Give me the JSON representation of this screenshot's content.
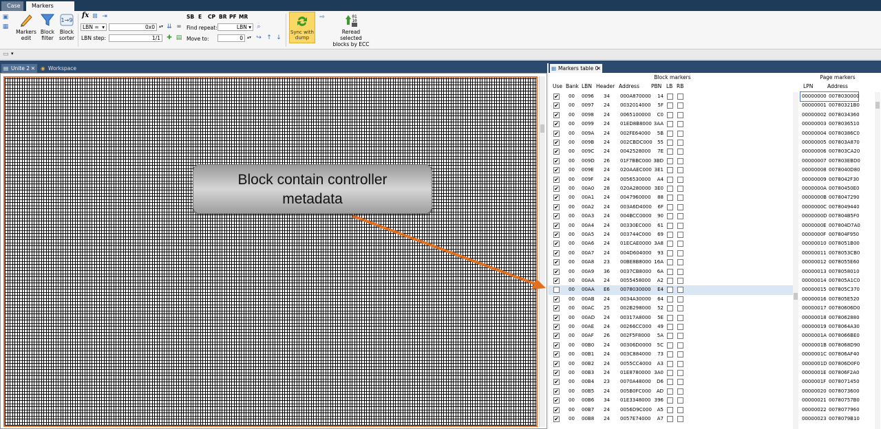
{
  "ribbon_tabs": [
    "Case",
    "Markers table"
  ],
  "toolbar": {
    "markers_edit": "Markers\nedit",
    "block_filter": "Block\nfilter",
    "block_sorter": "Block\nsorter",
    "fx_label": "fx",
    "lbn_selector": "LBN =",
    "lbn_value": "0x0",
    "lbn_step_label": "LBN step:",
    "lbn_step_value": "1/1",
    "format_buttons": [
      "SB",
      "E",
      "CP",
      "BR",
      "PF",
      "MR"
    ],
    "find_repeat_label": "Find repeat:",
    "find_repeat_value": "LBN",
    "move_to_label": "Move to:",
    "move_to_value": "0",
    "sync_label": "Sync with\ndump",
    "reread_label": "Reread selected\nblocks by ECC"
  },
  "doc_tabs": {
    "left": [
      "Unite 2",
      "Workspace"
    ],
    "right": [
      "Markers table 0"
    ]
  },
  "block_markers": {
    "title": "Block markers",
    "columns": [
      "Use",
      "Bank",
      "LBN",
      "Header",
      "Address",
      "PBN",
      "LB",
      "RB"
    ],
    "rows": [
      {
        "use": true,
        "bank": "00",
        "lbn": "0096",
        "header": "34",
        "address": "000A870000",
        "pbn": "14"
      },
      {
        "use": true,
        "bank": "00",
        "lbn": "0097",
        "header": "24",
        "address": "0032014000",
        "pbn": "5F"
      },
      {
        "use": true,
        "bank": "00",
        "lbn": "0098",
        "header": "24",
        "address": "0065100000",
        "pbn": "C0"
      },
      {
        "use": true,
        "bank": "00",
        "lbn": "0099",
        "header": "24",
        "address": "01ED8B8000",
        "pbn": "3AA"
      },
      {
        "use": true,
        "bank": "00",
        "lbn": "009A",
        "header": "24",
        "address": "002FE64000",
        "pbn": "5B"
      },
      {
        "use": true,
        "bank": "00",
        "lbn": "009B",
        "header": "24",
        "address": "002CBDC000",
        "pbn": "55"
      },
      {
        "use": true,
        "bank": "00",
        "lbn": "009C",
        "header": "24",
        "address": "0042528000",
        "pbn": "7E"
      },
      {
        "use": true,
        "bank": "00",
        "lbn": "009D",
        "header": "26",
        "address": "01F7BBC000",
        "pbn": "3BD"
      },
      {
        "use": true,
        "bank": "00",
        "lbn": "009E",
        "header": "24",
        "address": "020AAEC000",
        "pbn": "3E1"
      },
      {
        "use": true,
        "bank": "00",
        "lbn": "009F",
        "header": "24",
        "address": "0056530000",
        "pbn": "A4"
      },
      {
        "use": true,
        "bank": "00",
        "lbn": "00A0",
        "header": "28",
        "address": "020A280000",
        "pbn": "3E0"
      },
      {
        "use": true,
        "bank": "00",
        "lbn": "00A1",
        "header": "24",
        "address": "0047960000",
        "pbn": "88"
      },
      {
        "use": true,
        "bank": "00",
        "lbn": "00A2",
        "header": "24",
        "address": "003A6D4000",
        "pbn": "6F"
      },
      {
        "use": true,
        "bank": "00",
        "lbn": "00A3",
        "header": "24",
        "address": "004BCC0000",
        "pbn": "90"
      },
      {
        "use": true,
        "bank": "00",
        "lbn": "00A4",
        "header": "24",
        "address": "00330EC000",
        "pbn": "61"
      },
      {
        "use": true,
        "bank": "00",
        "lbn": "00A5",
        "header": "24",
        "address": "003744C000",
        "pbn": "69"
      },
      {
        "use": true,
        "bank": "00",
        "lbn": "00A6",
        "header": "24",
        "address": "01ECAE0000",
        "pbn": "3A8"
      },
      {
        "use": true,
        "bank": "00",
        "lbn": "00A7",
        "header": "24",
        "address": "004D604000",
        "pbn": "93"
      },
      {
        "use": true,
        "bank": "00",
        "lbn": "00A8",
        "header": "23",
        "address": "00BE8B8000",
        "pbn": "16A"
      },
      {
        "use": true,
        "bank": "00",
        "lbn": "00A9",
        "header": "36",
        "address": "0037CB8000",
        "pbn": "6A"
      },
      {
        "use": true,
        "bank": "00",
        "lbn": "00AA",
        "header": "24",
        "address": "0055458000",
        "pbn": "A2"
      },
      {
        "use": false,
        "bank": "00",
        "lbn": "00AA",
        "header": "E6",
        "address": "0078030000",
        "pbn": "E4",
        "selected": true
      },
      {
        "use": true,
        "bank": "00",
        "lbn": "00AB",
        "header": "24",
        "address": "0034A30000",
        "pbn": "64"
      },
      {
        "use": true,
        "bank": "00",
        "lbn": "00AC",
        "header": "25",
        "address": "002B298000",
        "pbn": "52"
      },
      {
        "use": true,
        "bank": "00",
        "lbn": "00AD",
        "header": "24",
        "address": "00317A8000",
        "pbn": "5E"
      },
      {
        "use": true,
        "bank": "00",
        "lbn": "00AE",
        "header": "24",
        "address": "00266CC000",
        "pbn": "49"
      },
      {
        "use": true,
        "bank": "00",
        "lbn": "00AF",
        "header": "26",
        "address": "002F5F8000",
        "pbn": "5A"
      },
      {
        "use": true,
        "bank": "00",
        "lbn": "00B0",
        "header": "24",
        "address": "00306D0000",
        "pbn": "5C"
      },
      {
        "use": true,
        "bank": "00",
        "lbn": "00B1",
        "header": "24",
        "address": "003C884000",
        "pbn": "73"
      },
      {
        "use": true,
        "bank": "00",
        "lbn": "00B2",
        "header": "24",
        "address": "0055CC4000",
        "pbn": "A3"
      },
      {
        "use": true,
        "bank": "00",
        "lbn": "00B3",
        "header": "24",
        "address": "01E8780000",
        "pbn": "3A0"
      },
      {
        "use": true,
        "bank": "00",
        "lbn": "00B4",
        "header": "23",
        "address": "0070A48000",
        "pbn": "D6"
      },
      {
        "use": true,
        "bank": "00",
        "lbn": "00B5",
        "header": "24",
        "address": "005B0FC000",
        "pbn": "AD"
      },
      {
        "use": true,
        "bank": "00",
        "lbn": "00B6",
        "header": "34",
        "address": "01E3348000",
        "pbn": "396"
      },
      {
        "use": true,
        "bank": "00",
        "lbn": "00B7",
        "header": "24",
        "address": "0056D9C000",
        "pbn": "A5"
      },
      {
        "use": true,
        "bank": "00",
        "lbn": "00B8",
        "header": "24",
        "address": "0057E74000",
        "pbn": "A7"
      }
    ]
  },
  "page_markers": {
    "title": "Page markers",
    "columns": [
      "LPN",
      "Address"
    ],
    "rows": [
      {
        "lpn": "00000000",
        "address": "0078030000",
        "selected": true
      },
      {
        "lpn": "00000001",
        "address": "00780321B0"
      },
      {
        "lpn": "00000002",
        "address": "0078034360"
      },
      {
        "lpn": "00000003",
        "address": "0078036510"
      },
      {
        "lpn": "00000004",
        "address": "00780386C0"
      },
      {
        "lpn": "00000005",
        "address": "007803A870"
      },
      {
        "lpn": "00000006",
        "address": "007803CA20"
      },
      {
        "lpn": "00000007",
        "address": "007803EBD0"
      },
      {
        "lpn": "00000008",
        "address": "0078040D80"
      },
      {
        "lpn": "00000009",
        "address": "0078042F30"
      },
      {
        "lpn": "0000000A",
        "address": "00780450E0"
      },
      {
        "lpn": "0000000B",
        "address": "0078047290"
      },
      {
        "lpn": "0000000C",
        "address": "0078049440"
      },
      {
        "lpn": "0000000D",
        "address": "007804B5F0"
      },
      {
        "lpn": "0000000E",
        "address": "007804D7A0"
      },
      {
        "lpn": "0000000F",
        "address": "007804F950"
      },
      {
        "lpn": "00000010",
        "address": "0078051B00"
      },
      {
        "lpn": "00000011",
        "address": "0078053CB0"
      },
      {
        "lpn": "00000012",
        "address": "0078055E60"
      },
      {
        "lpn": "00000013",
        "address": "0078058010"
      },
      {
        "lpn": "00000014",
        "address": "007805A1C0"
      },
      {
        "lpn": "00000015",
        "address": "007805C370"
      },
      {
        "lpn": "00000016",
        "address": "007805E520"
      },
      {
        "lpn": "00000017",
        "address": "00780606D0"
      },
      {
        "lpn": "00000018",
        "address": "0078062880"
      },
      {
        "lpn": "00000019",
        "address": "0078064A30"
      },
      {
        "lpn": "0000001A",
        "address": "0078066BE0"
      },
      {
        "lpn": "0000001B",
        "address": "0078068D90"
      },
      {
        "lpn": "0000001C",
        "address": "007806AF40"
      },
      {
        "lpn": "0000001D",
        "address": "007806D0F0"
      },
      {
        "lpn": "0000001E",
        "address": "007806F2A0"
      },
      {
        "lpn": "0000001F",
        "address": "0078071450"
      },
      {
        "lpn": "00000020",
        "address": "0078073600"
      },
      {
        "lpn": "00000021",
        "address": "00780757B0"
      },
      {
        "lpn": "00000022",
        "address": "0078077960"
      },
      {
        "lpn": "00000023",
        "address": "0078079B10"
      }
    ]
  },
  "callout": {
    "text_line1": "Block contain controller",
    "text_line2": "metadata",
    "arrow_color": "#e07020"
  },
  "colors": {
    "ribbon_dark": "#1f3b5a",
    "sync_button": "#fbd865",
    "hex_border": "#e07030",
    "row_highlight": "#dbe6f4"
  }
}
